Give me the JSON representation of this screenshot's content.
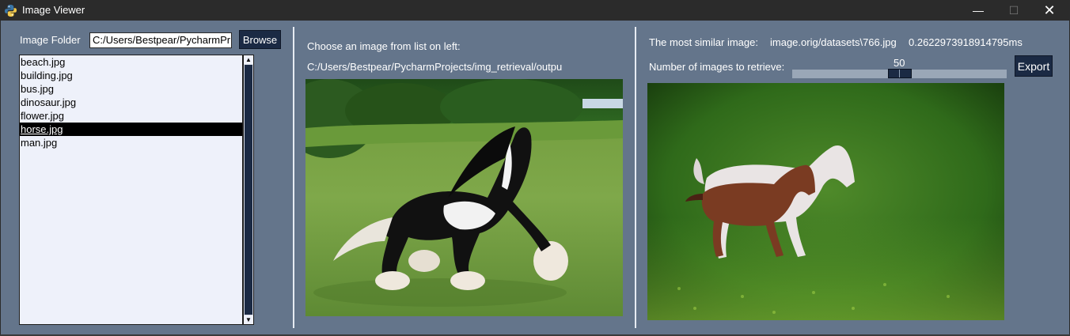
{
  "window": {
    "title": "Image Viewer",
    "minimize_glyph": "—",
    "maximize_glyph": "☐",
    "close_glyph": "✕"
  },
  "left_panel": {
    "folder_label": "Image Folder",
    "folder_value": "C:/Users/Bestpear/PycharmPr",
    "browse_label": "Browse",
    "files": [
      {
        "name": "beach.jpg",
        "selected": false
      },
      {
        "name": "building.jpg",
        "selected": false
      },
      {
        "name": "bus.jpg",
        "selected": false
      },
      {
        "name": "dinosaur.jpg",
        "selected": false
      },
      {
        "name": "flower.jpg",
        "selected": false
      },
      {
        "name": "horse.jpg",
        "selected": true
      },
      {
        "name": "man.jpg",
        "selected": false
      }
    ],
    "scroll_up_glyph": "▲",
    "scroll_down_glyph": "▼"
  },
  "middle_panel": {
    "instruction": "Choose an image from list on left:",
    "selected_path": "C:/Users/Bestpear/PycharmProjects/img_retrieval/outpu"
  },
  "right_panel": {
    "most_similar_label": "The most similar image:",
    "most_similar_path": "image.orig/datasets\\766.jpg",
    "elapsed": "0.2622973918914795ms",
    "retrieve_label": "Number of images to retrieve:",
    "retrieve_count": "50",
    "export_label": "Export"
  },
  "colors": {
    "panel_bg": "#64758b",
    "button_bg": "#1b2a44",
    "listbox_bg": "#eef1fa",
    "titlebar_bg": "#2b2b2b"
  },
  "icons": {
    "app": "python-icon",
    "preview_image": "piebald-horse-galloping-photo",
    "result_image": "mare-and-foal-photo"
  }
}
